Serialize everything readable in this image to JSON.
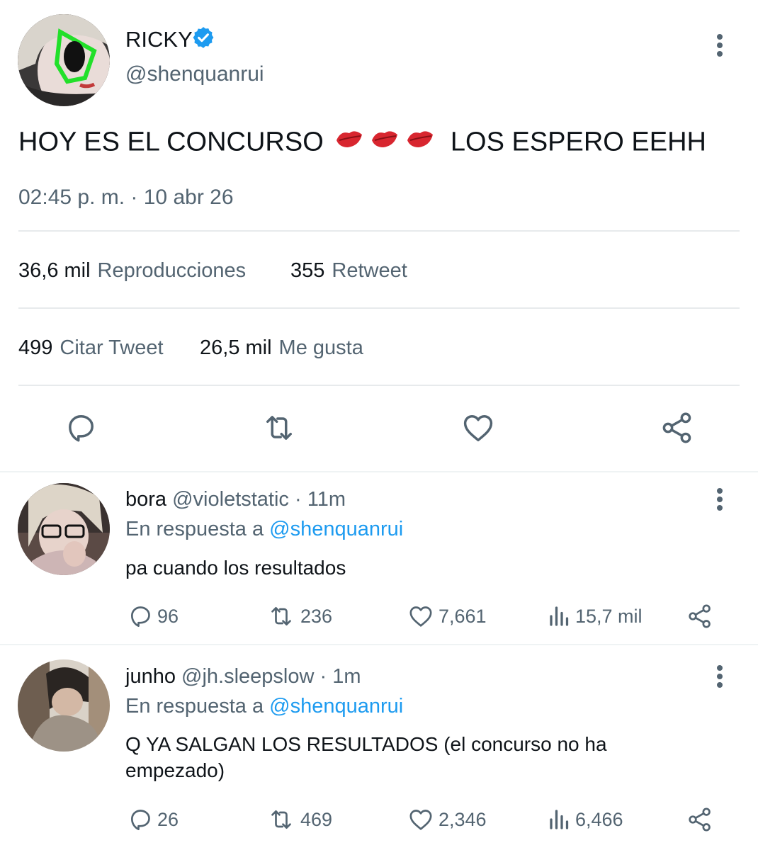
{
  "main_tweet": {
    "display_name": "RICKY",
    "handle": "@shenquanrui",
    "text_part1": "HOY ES EL CONCURSO",
    "emoji": "💋💋💋",
    "text_part2": "LOS ESPERO EEHH",
    "timestamp": "02:45 p. m. · 10 abr 26",
    "views_count": "36,6 mil",
    "views_label": "Reproducciones",
    "retweets_count": "355",
    "retweets_label": "Retweet",
    "quotes_count": "499",
    "quotes_label": "Citar Tweet",
    "likes_count": "26,5 mil",
    "likes_label": "Me gusta"
  },
  "replies": [
    {
      "name": "bora",
      "handle": "@violetstatic",
      "time": "· 11m",
      "reply_prefix": "En respuesta a",
      "reply_to": "@shenquanrui",
      "text": "pa cuando los resultados",
      "comments": "96",
      "retweets": "236",
      "likes": "7,661",
      "views": "15,7 mil"
    },
    {
      "name": "junho",
      "handle": "@jh.sleepslow",
      "time": "· 1m",
      "reply_prefix": "En respuesta a",
      "reply_to": "@shenquanrui",
      "text": "Q YA SALGAN LOS RESULTADOS (el concurso no ha empezado)",
      "comments": "26",
      "retweets": "469",
      "likes": "2,346",
      "views": "6,466"
    }
  ],
  "icons": {
    "verified": "verified-badge-icon",
    "more": "more-options-icon",
    "reply": "reply-icon",
    "retweet": "retweet-icon",
    "like": "heart-icon",
    "share": "share-icon",
    "views": "views-icon"
  },
  "colors": {
    "verified": "#1d9bf0",
    "muted": "#536471",
    "link": "#1d9bf0",
    "glasses": "#22e02a",
    "kiss": "#d8262f"
  }
}
